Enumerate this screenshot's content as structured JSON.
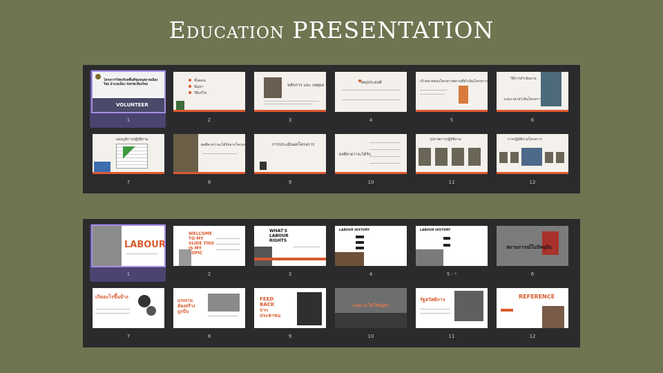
{
  "page_title": "Education  PRESENTATION",
  "deck1": {
    "slides": [
      {
        "num": "1",
        "selected": true,
        "texts": [
          "โครงการวิจัยบริบทพื้นที่ชุมชนตลาดเมืองใหม่ อำเภอเมือง จังหวัดเชียงใหม่",
          "VOLUNTEER"
        ]
      },
      {
        "num": "2",
        "texts": [
          "ขั้นตอน",
          "ปัญหา",
          "วิธีแก้ไข"
        ]
      },
      {
        "num": "3",
        "texts": [
          "หลักการ และ เหตุผล"
        ]
      },
      {
        "num": "4",
        "texts": [
          "วัตถุประสงค์"
        ]
      },
      {
        "num": "5",
        "texts": [
          "เป้าหมายของโครงการ",
          "สถานที่ดำเนินโครงการ"
        ]
      },
      {
        "num": "6",
        "texts": [
          "วิธีการดำเนินงาน",
          "ระยะเวลาดำเนินโครงการ"
        ]
      },
      {
        "num": "7",
        "texts": [
          "แผนภูมิการปฏิบัติงาน"
        ]
      },
      {
        "num": "8",
        "texts": [
          "ผลที่คาดว่าจะได้รับจากโครงการ"
        ]
      },
      {
        "num": "9",
        "texts": [
          "การประเมินผลโครงการ"
        ]
      },
      {
        "num": "10",
        "texts": [
          "ผลที่คาดว่าจะได้รับ"
        ]
      },
      {
        "num": "11",
        "texts": [
          "รูปภาพการปฏิบัติงาน"
        ]
      },
      {
        "num": "12",
        "texts": [
          "การปฏิบัติงานโครงการ"
        ]
      }
    ]
  },
  "deck2": {
    "slides": [
      {
        "num": "1",
        "selected": true,
        "texts": [
          "LABOUR"
        ]
      },
      {
        "num": "2",
        "texts": [
          "WELCOME TO MY SLIDE THIS IS MY TOPIC"
        ]
      },
      {
        "num": "3",
        "texts": [
          "WHAT'S LABOUR RIGHTS"
        ]
      },
      {
        "num": "4",
        "texts": [
          "LABOUR HISTORY"
        ]
      },
      {
        "num": "5 - ²",
        "texts": [
          "LABOUR HISTORY"
        ]
      },
      {
        "num": "6",
        "texts": [
          "สถานการณ์ในปัจจุบัน"
        ]
      },
      {
        "num": "7",
        "texts": [
          "เกิดอะไรขึ้นบ้าง"
        ]
      },
      {
        "num": "8",
        "texts": [
          "แรงงาน ต้องสร้าง ถูกบีบ"
        ]
      },
      {
        "num": "9",
        "texts": [
          "FEED BACK จาก ประชาชน"
        ]
      },
      {
        "num": "10",
        "texts": [
          "แรงงาน ไม่ใช่ปัญหา"
        ]
      },
      {
        "num": "11",
        "texts": [
          "รัฐสวัสดิการ"
        ]
      },
      {
        "num": "12",
        "texts": [
          "REFERENCE"
        ]
      }
    ]
  }
}
